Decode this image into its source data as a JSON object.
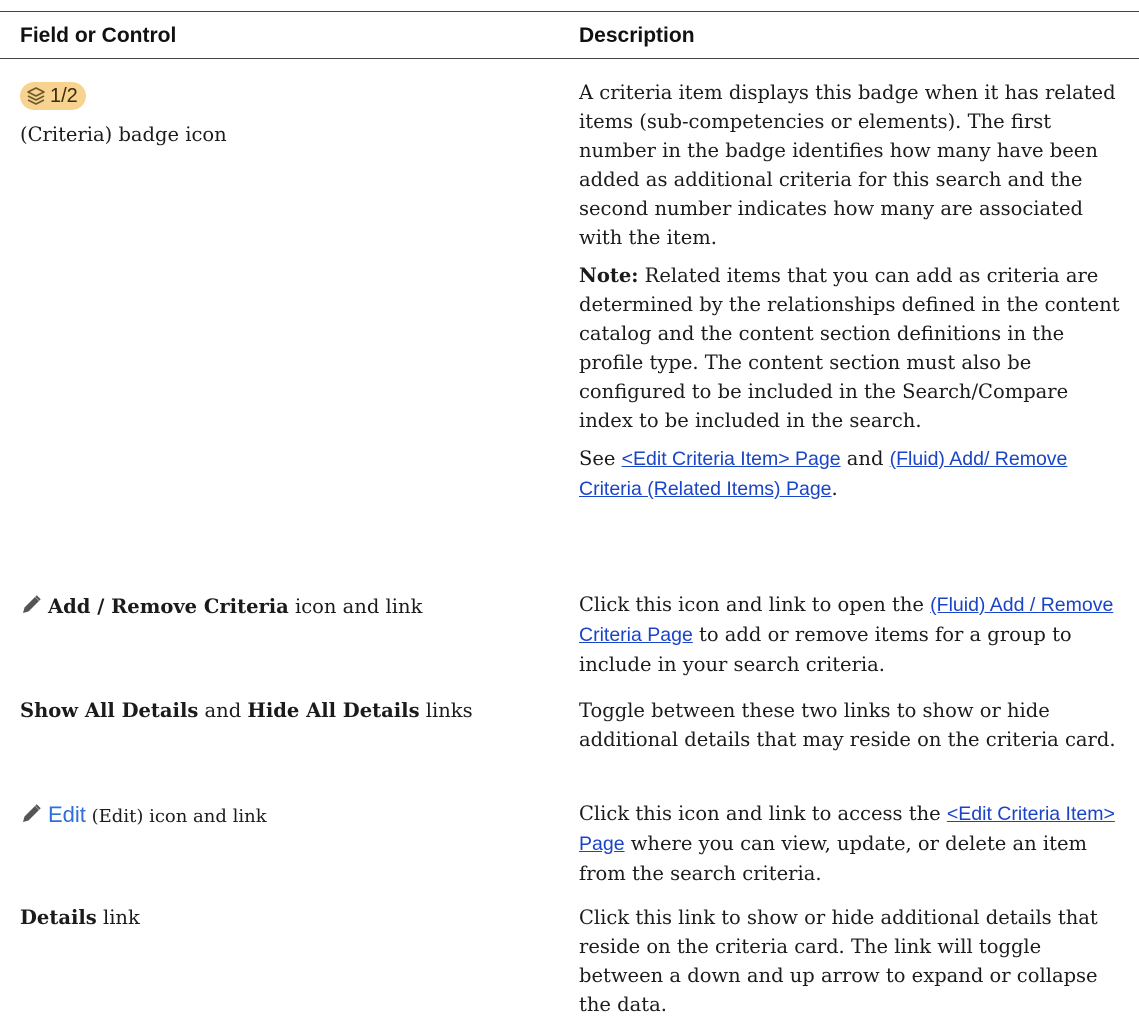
{
  "header": {
    "col1": "Field or Control",
    "col2": "Description"
  },
  "rows": [
    {
      "badge_text": "1/2",
      "badge_icon": "layers-icon",
      "control_label": "(Criteria) badge icon",
      "desc_p1": "A criteria item displays this badge when it has related items (sub-competencies or elements). The first number in the badge identifies how many have been added as additional criteria for this search and the second number indicates how many are associated with the item.",
      "note_label": "Note:",
      "note_text": " Related items that you can add as criteria are determined by the relationships defined in the content catalog and the content section definitions in the profile type. The content section must also be configured to be included in the Search/Compare index to be included in the search.",
      "see_prefix": "See ",
      "see_link1": "<Edit Criteria Item> Page",
      "see_and": " and ",
      "see_link2": "(Fluid) Add/ Remove Criteria (Related Items) Page",
      "see_suffix": "."
    },
    {
      "icon": "pencil-icon",
      "control_bold": "Add / Remove Criteria",
      "control_rest": " icon and link",
      "desc_prefix": "Click this icon and link to open the ",
      "desc_link": "(Fluid) Add / Remove Criteria Page",
      "desc_suffix": " to add or remove items for a group to include in your search criteria."
    },
    {
      "control_bold1": "Show All Details",
      "control_and": " and ",
      "control_bold2": "Hide All Details",
      "control_rest": " links",
      "desc": "Toggle between these two links to show or hide additional details that may reside on the criteria card."
    },
    {
      "icon": "pencil-icon",
      "edit_text": "Edit",
      "control_rest": " (Edit) icon and link",
      "desc_prefix": "Click this icon and link to access the ",
      "desc_link": "<Edit Criteria Item> Page",
      "desc_suffix": " where you can view, update, or delete an item from the search criteria."
    },
    {
      "control_bold": "Details",
      "control_rest": " link",
      "desc": "Click this link to show or hide additional details that reside on the criteria card. The link will toggle between a down and up arrow to expand or collapse the data."
    }
  ]
}
